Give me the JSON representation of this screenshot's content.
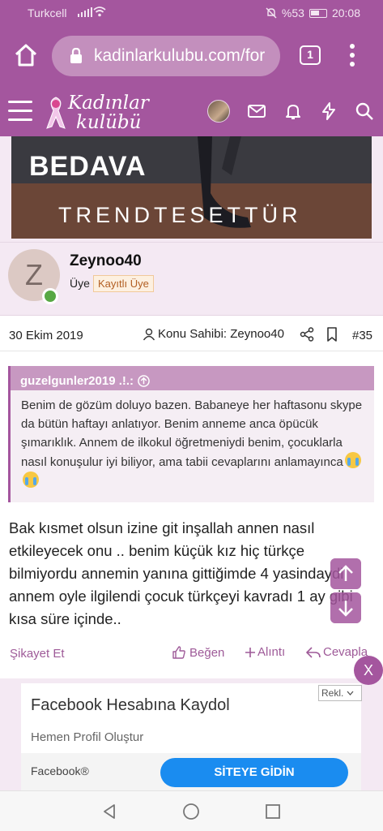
{
  "status_bar": {
    "carrier": "Turkcell",
    "battery": "%53",
    "time": "20:08"
  },
  "browser": {
    "url": "kadinlarkulubu.com/for",
    "tab_count": "1"
  },
  "site_header": {
    "logo_line1": "Kadınlar",
    "logo_line2": "kulübü"
  },
  "banner": {
    "tagline": "BEDAVA",
    "brand": "TRENDTESETTÜR"
  },
  "post": {
    "author": {
      "initial": "Z",
      "name": "Zeynoo40",
      "role": "Üye",
      "badge": "Kayıtlı Üye"
    },
    "date": "30 Ekim 2019",
    "owner_label": "Konu Sahibi: Zeynoo40",
    "number": "#35",
    "quote": {
      "author": "guzelgunler2019 .!.:",
      "text": "Benim de gözüm doluyo bazen. Babaneye her haftasonu skype da bütün haftayı anlatıyor. Benim anneme anca öpücük şımarıklık. Annem de ilkokul öğretmeniydi benim, çocuklarla nasıl konuşulur iyi biliyor, ama tabii cevaplarını anlamayınca"
    },
    "message": "Bak kısmet olsun izine git inşallah annen nasıl etkileyecek onu .. benim küçük kız hiç türkçe bilmiyordu annemin yanına gittiğimde 4 yasindaydi annem oyle ilgilendi çocuk türkçeyi kavradı 1 ay gibi kısa süre içinde..",
    "actions": {
      "report": "Şikayet Et",
      "like": "Beğen",
      "quote": "Alıntı",
      "reply": "Cevapla"
    }
  },
  "close_label": "X",
  "ad": {
    "label": "Rekl.",
    "title": "Facebook Hesabına Kaydol",
    "subtitle": "Hemen Profil Oluştur",
    "source": "Facebook®",
    "cta": "SİTEYE GİDİN"
  },
  "colors": {
    "brand": "#a4569e",
    "cta_blue": "#1a8cf0",
    "online": "#57a844"
  }
}
